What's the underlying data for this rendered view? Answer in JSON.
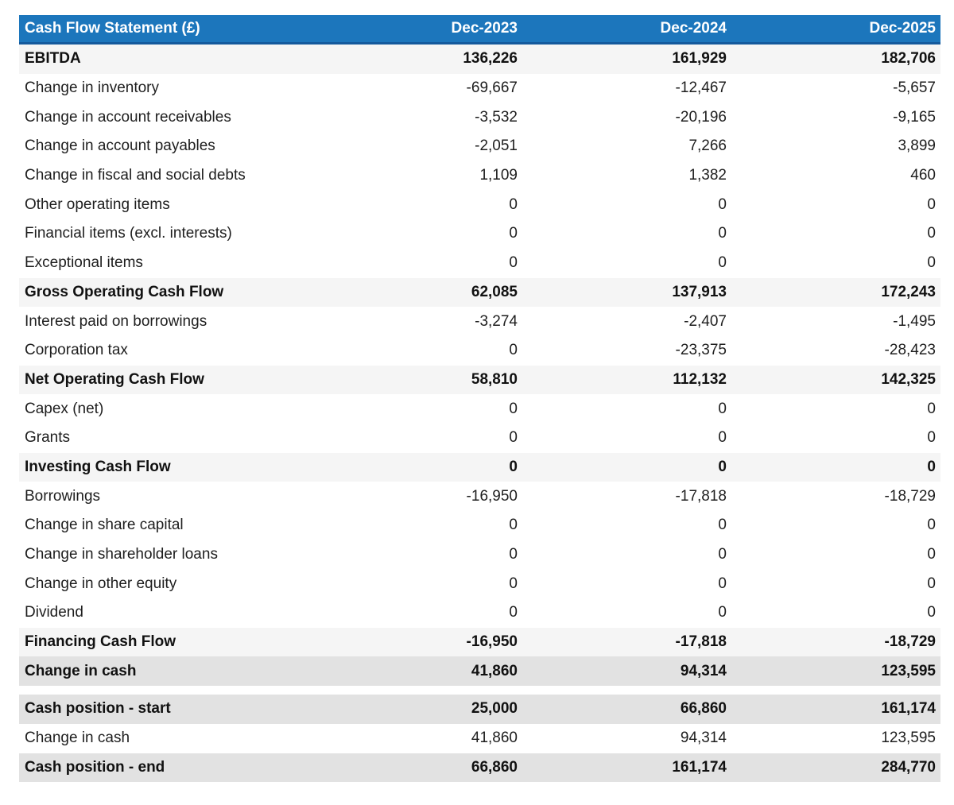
{
  "table": {
    "header": {
      "title": "Cash Flow Statement (£)",
      "columns": [
        "Dec-2023",
        "Dec-2024",
        "Dec-2025"
      ]
    },
    "rows": [
      {
        "label": "EBITDA",
        "values": [
          "136,226",
          "161,929",
          "182,706"
        ],
        "style": "subtotal"
      },
      {
        "label": "Change in inventory",
        "values": [
          "-69,667",
          "-12,467",
          "-5,657"
        ],
        "style": "normal"
      },
      {
        "label": "Change in account receivables",
        "values": [
          "-3,532",
          "-20,196",
          "-9,165"
        ],
        "style": "normal"
      },
      {
        "label": "Change in account payables",
        "values": [
          "-2,051",
          "7,266",
          "3,899"
        ],
        "style": "normal"
      },
      {
        "label": "Change in fiscal and social debts",
        "values": [
          "1,109",
          "1,382",
          "460"
        ],
        "style": "normal"
      },
      {
        "label": "Other operating items",
        "values": [
          "0",
          "0",
          "0"
        ],
        "style": "normal"
      },
      {
        "label": "Financial items (excl. interests)",
        "values": [
          "0",
          "0",
          "0"
        ],
        "style": "normal"
      },
      {
        "label": "Exceptional items",
        "values": [
          "0",
          "0",
          "0"
        ],
        "style": "normal"
      },
      {
        "label": "Gross Operating Cash Flow",
        "values": [
          "62,085",
          "137,913",
          "172,243"
        ],
        "style": "subtotal"
      },
      {
        "label": "Interest paid on borrowings",
        "values": [
          "-3,274",
          "-2,407",
          "-1,495"
        ],
        "style": "normal"
      },
      {
        "label": "Corporation tax",
        "values": [
          "0",
          "-23,375",
          "-28,423"
        ],
        "style": "normal"
      },
      {
        "label": "Net Operating Cash Flow",
        "values": [
          "58,810",
          "112,132",
          "142,325"
        ],
        "style": "subtotal"
      },
      {
        "label": "Capex (net)",
        "values": [
          "0",
          "0",
          "0"
        ],
        "style": "normal"
      },
      {
        "label": "Grants",
        "values": [
          "0",
          "0",
          "0"
        ],
        "style": "normal"
      },
      {
        "label": "Investing Cash Flow",
        "values": [
          "0",
          "0",
          "0"
        ],
        "style": "subtotal"
      },
      {
        "label": "Borrowings",
        "values": [
          "-16,950",
          "-17,818",
          "-18,729"
        ],
        "style": "normal"
      },
      {
        "label": "Change in share capital",
        "values": [
          "0",
          "0",
          "0"
        ],
        "style": "normal"
      },
      {
        "label": "Change in shareholder loans",
        "values": [
          "0",
          "0",
          "0"
        ],
        "style": "normal"
      },
      {
        "label": "Change in other equity",
        "values": [
          "0",
          "0",
          "0"
        ],
        "style": "normal"
      },
      {
        "label": "Dividend",
        "values": [
          "0",
          "0",
          "0"
        ],
        "style": "normal"
      },
      {
        "label": "Financing Cash Flow",
        "values": [
          "-16,950",
          "-17,818",
          "-18,729"
        ],
        "style": "subtotal"
      },
      {
        "label": "Change in cash",
        "values": [
          "41,860",
          "94,314",
          "123,595"
        ],
        "style": "total"
      }
    ],
    "footer_rows": [
      {
        "label": "Cash position - start",
        "values": [
          "25,000",
          "66,860",
          "161,174"
        ],
        "style": "total"
      },
      {
        "label": "Change in cash",
        "values": [
          "41,860",
          "94,314",
          "123,595"
        ],
        "style": "normal"
      },
      {
        "label": "Cash position - end",
        "values": [
          "66,860",
          "161,174",
          "284,770"
        ],
        "style": "total"
      }
    ],
    "colors": {
      "header_bg": "#1c76bc",
      "header_border": "#14599c",
      "subtotal_row_bg": "#f5f5f5",
      "total_row_bg": "#e2e2e2",
      "header_text": "#ffffff",
      "body_text": "#1e1e1e"
    }
  }
}
